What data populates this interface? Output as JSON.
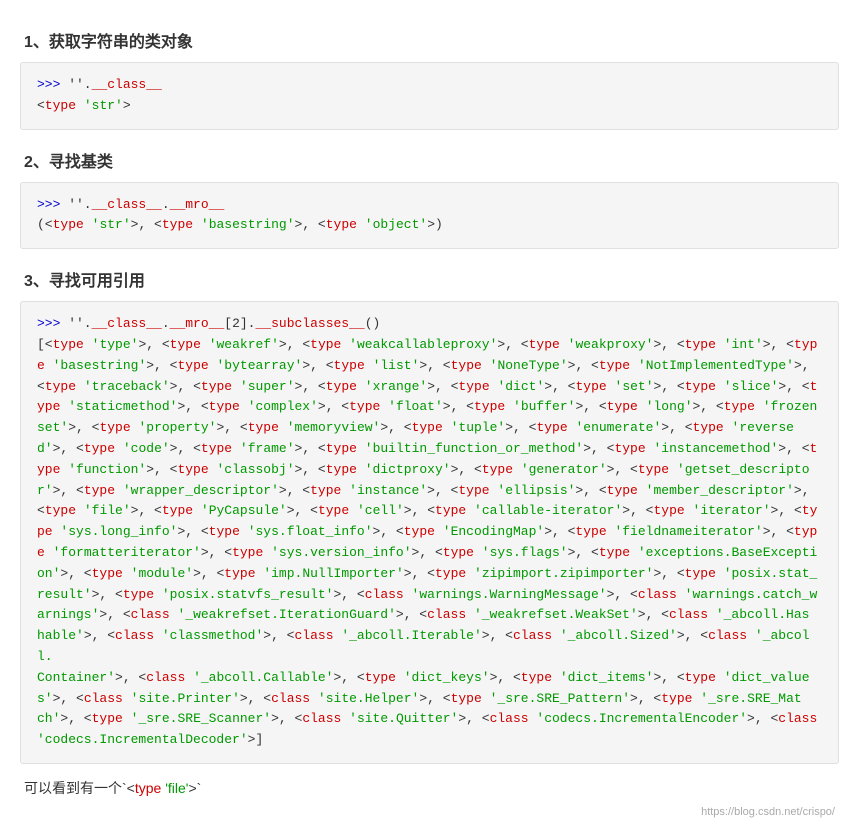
{
  "sections": [
    {
      "id": "section1",
      "title": "1、获取字符串的类对象",
      "code_lines": [
        {
          "type": "prompt",
          "text": ">>> ''."
        },
        {
          "type": "attr",
          "text": "__class__"
        },
        {
          "type": "newline"
        },
        {
          "type": "normal",
          "text": "<"
        },
        {
          "type": "type_kw",
          "text": "type"
        },
        {
          "type": "normal",
          "text": " "
        },
        {
          "type": "str_val",
          "text": "'str'"
        },
        {
          "type": "normal",
          "text": ">"
        }
      ]
    },
    {
      "id": "section2",
      "title": "2、寻找基类",
      "code_lines": []
    },
    {
      "id": "section3",
      "title": "3、寻找可用引用",
      "code_lines": []
    }
  ],
  "watermark": "https://blog.csdn.net/crispo/",
  "bottom_note": "可以看到有一个`<type 'file'>`"
}
